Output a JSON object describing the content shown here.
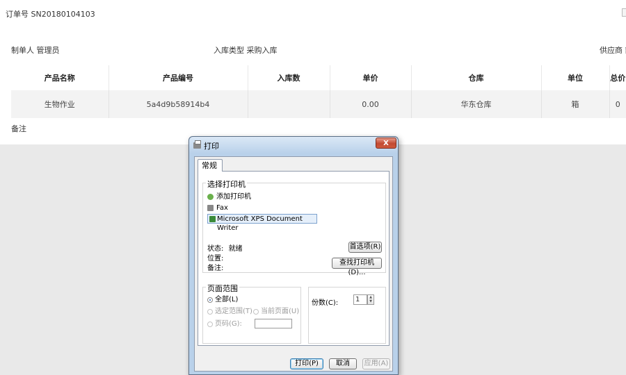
{
  "page": {
    "order_no": "订单号 SN20180104103",
    "creator": "制单人 管理员",
    "instock_type": "入库类型 采购入库",
    "supplier": "供应商 散",
    "remark_label": "备注",
    "table": {
      "columns": [
        "产品名称",
        "产品编号",
        "入库数",
        "单价",
        "仓库",
        "单位",
        "总价"
      ],
      "rows": [
        [
          "生物作业",
          "5a4d9b58914b4",
          "",
          "0.00",
          "华东仓库",
          "箱",
          "0"
        ]
      ]
    }
  },
  "dialog": {
    "title": "打印",
    "close_label": "X",
    "tab_label": "常规",
    "printer_group_title": "选择打印机",
    "printers": [
      "添加打印机",
      "Fax",
      "Microsoft XPS Document Writer"
    ],
    "selected_printer": "Microsoft XPS Document Writer",
    "status_label": "状态:",
    "status_value": "就绪",
    "location_label": "位置:",
    "comment_label": "备注:",
    "preferences_button": "首选项(R)",
    "find_printer_button": "查找打印机(D)...",
    "page_range_title": "页面范围",
    "radio_all": "全部(L)",
    "radio_selection": "选定范围(T)",
    "radio_current_page": "当前页面(U)",
    "radio_pages": "页码(G):",
    "page_range_value": "",
    "copies_label": "份数(C):",
    "copies_value": "1",
    "print_button": "打印(P)",
    "cancel_button": "取消",
    "apply_button": "应用(A)"
  },
  "colors": {
    "dialog_frame": "#b9d1ea",
    "close_button": "#c24a32",
    "overlay_gray": "#e9e9e9",
    "row_bg": "#f3f3f3"
  },
  "icons": {
    "title": "printer-icon",
    "close": "close-icon",
    "add_printer": "add-printer-icon",
    "fax": "fax-printer-icon",
    "xps": "xps-printer-icon"
  }
}
